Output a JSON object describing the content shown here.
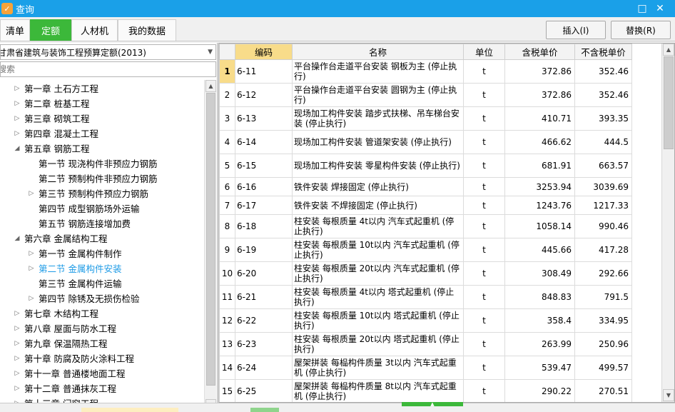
{
  "window": {
    "title": "查询",
    "app_icon": "search-app-icon",
    "restore_glyph": "□",
    "close_glyph": "✕"
  },
  "tabs": [
    {
      "label": "清单",
      "active": false
    },
    {
      "label": "定额",
      "active": true
    },
    {
      "label": "人材机",
      "active": false
    },
    {
      "label": "我的数据",
      "active": false
    }
  ],
  "actions": {
    "insert_label": "插入(I)",
    "replace_label": "替换(R)"
  },
  "left": {
    "library_selected": "甘肃省建筑与装饰工程预算定额(2013)",
    "search_placeholder": "搜索",
    "tree": [
      {
        "label": "第一章 土石方工程",
        "level": 0,
        "expander": "collapsed"
      },
      {
        "label": "第二章 桩基工程",
        "level": 0,
        "expander": "collapsed"
      },
      {
        "label": "第三章 砌筑工程",
        "level": 0,
        "expander": "collapsed"
      },
      {
        "label": "第四章 混凝土工程",
        "level": 0,
        "expander": "collapsed"
      },
      {
        "label": "第五章 钢筋工程",
        "level": 0,
        "expander": "expanded"
      },
      {
        "label": "第一节 现浇构件非预应力钢筋",
        "level": 1,
        "expander": "none"
      },
      {
        "label": "第二节 预制构件非预应力钢筋",
        "level": 1,
        "expander": "none"
      },
      {
        "label": "第三节 预制构件预应力钢筋",
        "level": 1,
        "expander": "collapsed"
      },
      {
        "label": "第四节 成型钢筋场外运输",
        "level": 1,
        "expander": "none"
      },
      {
        "label": "第五节 钢筋连接增加费",
        "level": 1,
        "expander": "none"
      },
      {
        "label": "第六章 金属结构工程",
        "level": 0,
        "expander": "expanded"
      },
      {
        "label": "第一节 金属构件制作",
        "level": 1,
        "expander": "collapsed"
      },
      {
        "label": "第二节 金属构件安装",
        "level": 1,
        "expander": "collapsed",
        "selected": true
      },
      {
        "label": "第三节 金属构件运输",
        "level": 1,
        "expander": "none"
      },
      {
        "label": "第四节 除锈及无损伤检验",
        "level": 1,
        "expander": "collapsed"
      },
      {
        "label": "第七章 木结构工程",
        "level": 0,
        "expander": "collapsed"
      },
      {
        "label": "第八章 屋面与防水工程",
        "level": 0,
        "expander": "collapsed"
      },
      {
        "label": "第九章 保温隔热工程",
        "level": 0,
        "expander": "collapsed"
      },
      {
        "label": "第十章 防腐及防火涂料工程",
        "level": 0,
        "expander": "collapsed"
      },
      {
        "label": "第十一章 普通楼地面工程",
        "level": 0,
        "expander": "collapsed"
      },
      {
        "label": "第十二章 普通抹灰工程",
        "level": 0,
        "expander": "collapsed"
      },
      {
        "label": "第十三章 门窗工程",
        "level": 0,
        "expander": "collapsed"
      }
    ]
  },
  "grid": {
    "columns": [
      "",
      "编码",
      "名称",
      "单位",
      "含税单价",
      "不含税单价"
    ],
    "rows": [
      {
        "idx": "1",
        "code": "6-11",
        "name": "平台操作台走道平台安装 钢板为主 (停止执行)",
        "unit": "t",
        "tax": "372.86",
        "notax": "352.46"
      },
      {
        "idx": "2",
        "code": "6-12",
        "name": "平台操作台走道平台安装 圆钢为主 (停止执行)",
        "unit": "t",
        "tax": "372.86",
        "notax": "352.46"
      },
      {
        "idx": "3",
        "code": "6-13",
        "name": "现场加工构件安装 踏步式扶梯、吊车梯台安装 (停止执行)",
        "unit": "t",
        "tax": "410.71",
        "notax": "393.35"
      },
      {
        "idx": "4",
        "code": "6-14",
        "name": "现场加工构件安装 管道架安装 (停止执行)",
        "unit": "t",
        "tax": "466.62",
        "notax": "444.5"
      },
      {
        "idx": "5",
        "code": "6-15",
        "name": "现场加工构件安装 零星构件安装 (停止执行)",
        "unit": "t",
        "tax": "681.91",
        "notax": "663.57"
      },
      {
        "idx": "6",
        "code": "6-16",
        "name": "铁件安装 焊接固定 (停止执行)",
        "unit": "t",
        "tax": "3253.94",
        "notax": "3039.69"
      },
      {
        "idx": "7",
        "code": "6-17",
        "name": "铁件安装 不焊接固定 (停止执行)",
        "unit": "t",
        "tax": "1243.76",
        "notax": "1217.33"
      },
      {
        "idx": "8",
        "code": "6-18",
        "name": "柱安装 每根质量 4t以内 汽车式起重机 (停止执行)",
        "unit": "t",
        "tax": "1058.14",
        "notax": "990.46"
      },
      {
        "idx": "9",
        "code": "6-19",
        "name": "柱安装 每根质量 10t以内 汽车式起重机 (停止执行)",
        "unit": "t",
        "tax": "445.66",
        "notax": "417.28"
      },
      {
        "idx": "10",
        "code": "6-20",
        "name": "柱安装 每根质量 20t以内 汽车式起重机 (停止执行)",
        "unit": "t",
        "tax": "308.49",
        "notax": "292.66"
      },
      {
        "idx": "11",
        "code": "6-21",
        "name": "柱安装 每根质量 4t以内 塔式起重机 (停止执行)",
        "unit": "t",
        "tax": "848.83",
        "notax": "791.5"
      },
      {
        "idx": "12",
        "code": "6-22",
        "name": "柱安装 每根质量 10t以内 塔式起重机 (停止执行)",
        "unit": "t",
        "tax": "358.4",
        "notax": "334.95"
      },
      {
        "idx": "13",
        "code": "6-23",
        "name": "柱安装 每根质量 20t以内 塔式起重机 (停止执行)",
        "unit": "t",
        "tax": "263.99",
        "notax": "250.96"
      },
      {
        "idx": "14",
        "code": "6-24",
        "name": "屋架拼装 每榀构件质量 3t以内 汽车式起重机 (停止执行)",
        "unit": "t",
        "tax": "539.47",
        "notax": "499.57"
      },
      {
        "idx": "15",
        "code": "6-25",
        "name": "屋架拼装 每榀构件质量 8t以内 汽车式起重机 (停止执行)",
        "unit": "t",
        "tax": "290.22",
        "notax": "270.51"
      }
    ]
  }
}
